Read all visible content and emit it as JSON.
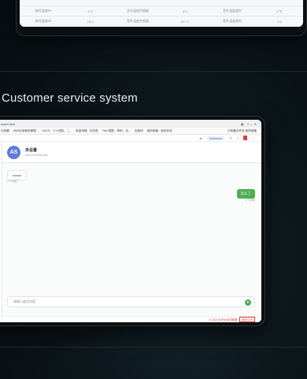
{
  "top_table": {
    "rows": [
      [
        "房间温度BP",
        "0°C",
        "室内温度传感器",
        "3°C",
        "室外温度超时",
        "3 ℃"
      ],
      [
        "房间温度BP",
        "18°C",
        "室外温度传感器",
        "50 °C",
        "室外温度超时",
        "2.6"
      ]
    ]
  },
  "section": {
    "title": "Customer service system"
  },
  "browser": {
    "tab_title": "index.html",
    "bookmarks": [
      "已收藏",
      "Web应用程序管理...",
      "ASCII、十六进制、二...",
      "批量传输 · 在线表",
      "Yian 规图、单例、也...",
      "百度网",
      "我的收藏 · 哈哈在线"
    ],
    "bookmarks_right": "已收藏文件夹  我的收藏",
    "url_pill": "Unknown"
  },
  "chat": {
    "avatar_text": "AS",
    "contact_name": "未设置",
    "contact_sub": "ANCD1879804384",
    "incoming_message": "nonon",
    "incoming_time": "1个月前",
    "outgoing_message": "怎么了",
    "outgoing_time": "1个月前",
    "input_placeholder": "请输入留言内容",
    "send_symbol": "➤"
  },
  "footer": {
    "text": "© 2022 NoPal 私流客服",
    "link": "聊天中天"
  }
}
